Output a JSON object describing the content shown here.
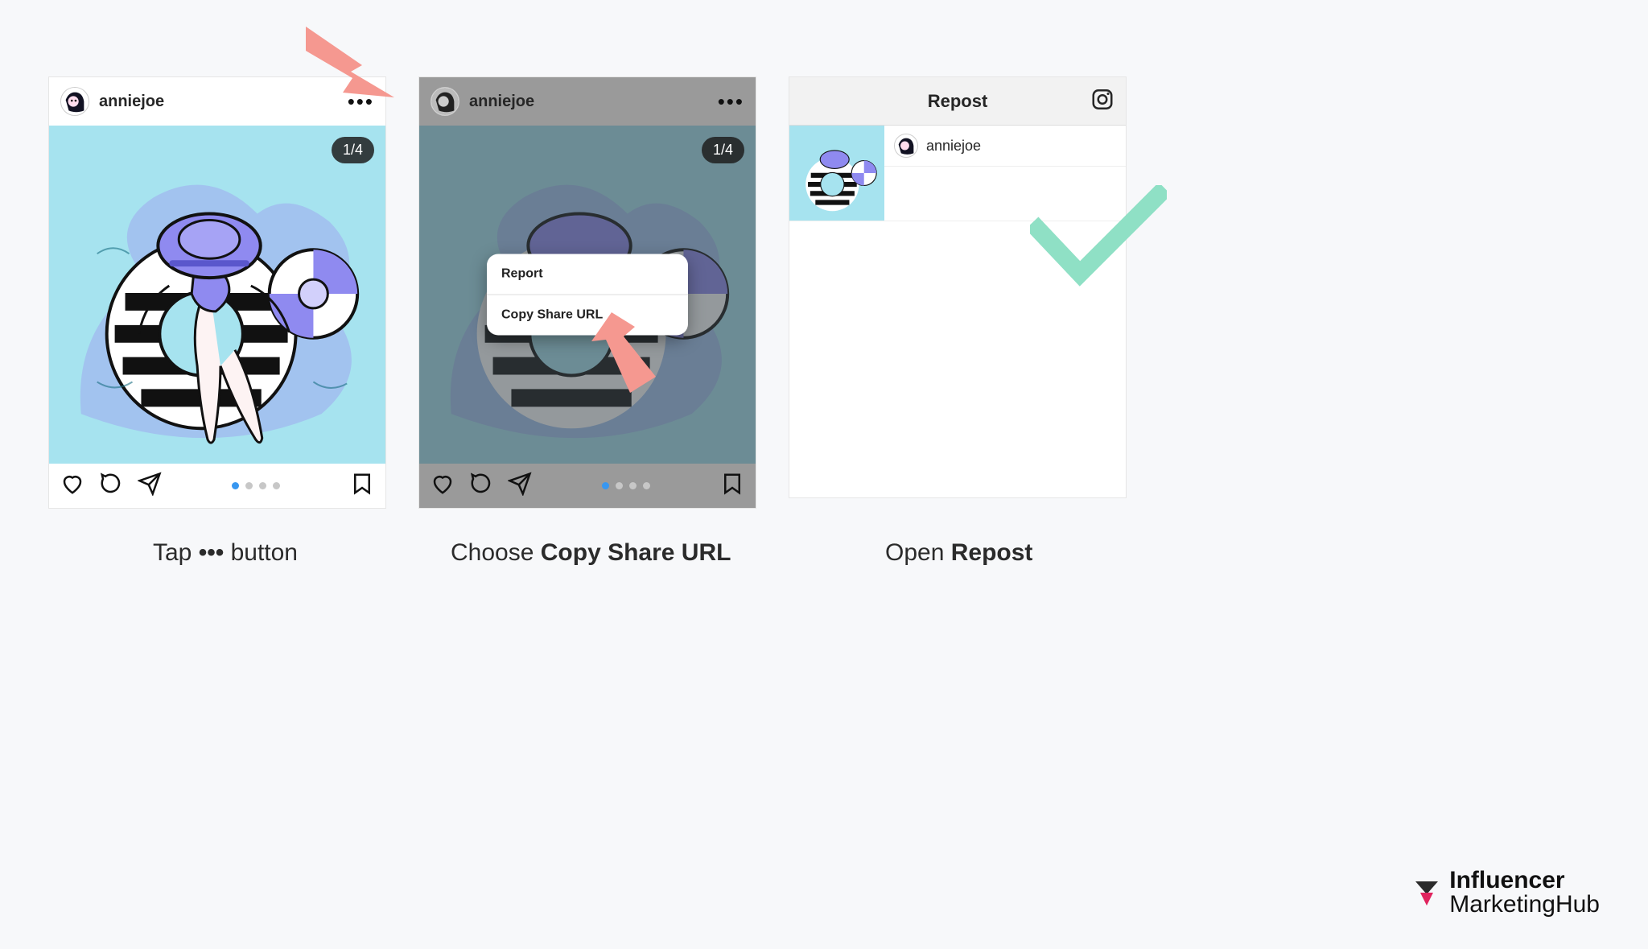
{
  "username": "anniejoe",
  "counter": "1/4",
  "sheet": {
    "report": "Report",
    "copy": "Copy Share URL"
  },
  "repost": {
    "title": "Repost"
  },
  "captions": {
    "c1_pre": "Tap ",
    "c1_post": " button",
    "c2_pre": "Choose ",
    "c2_bold": "Copy Share URL",
    "c3_pre": "Open ",
    "c3_bold": "Repost"
  },
  "brand": {
    "line1": "Influencer",
    "line2": "MarketingHub"
  }
}
